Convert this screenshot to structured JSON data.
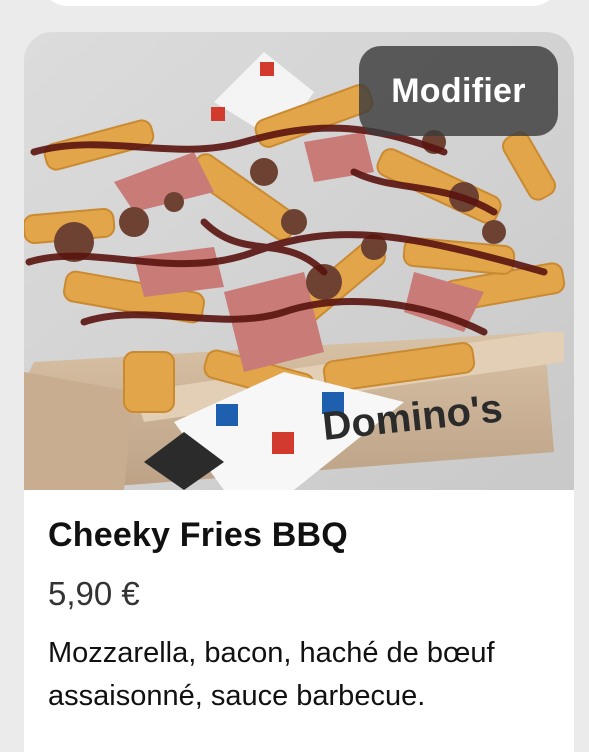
{
  "product": {
    "name": "Cheeky Fries BBQ",
    "price": "5,90 €",
    "description": "Mozzarella, bacon, haché de bœuf assaisonné, sauce barbecue.",
    "edit_label": "Modifier",
    "box_brand_text": "Domino's"
  },
  "icons": {
    "product_photo": "fries-box-image"
  },
  "colors": {
    "page_background": "#ebebeb",
    "card_background": "#ffffff",
    "edit_button_background": "#3c3c3c",
    "edit_button_text": "#ffffff",
    "title_text": "#111111",
    "price_text": "#333333"
  }
}
